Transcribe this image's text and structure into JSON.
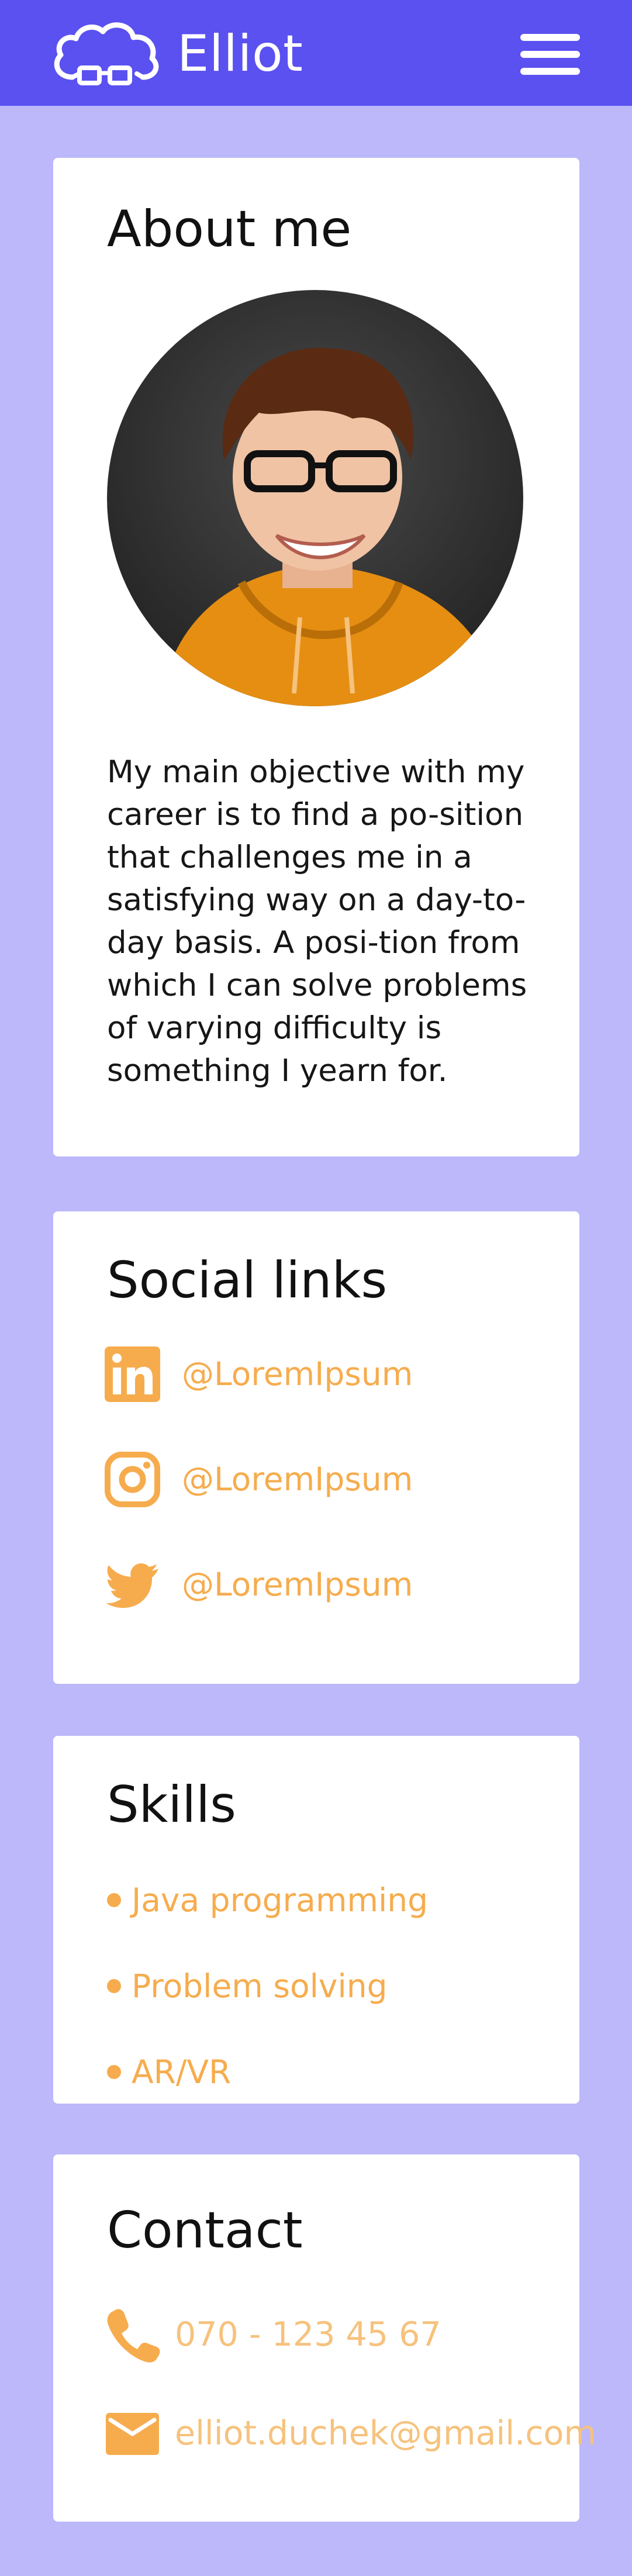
{
  "header": {
    "brand": "Elliot",
    "logo_icon": "cloud-with-glasses-icon",
    "menu_icon": "hamburger-menu-icon",
    "background": "#5a51f0"
  },
  "about": {
    "title": "About me",
    "bio": "My main objective with my career is to find a po-sition that challenges me in a satisfying way on a day-to-day basis. A posi-tion from which I can solve problems of varying difficulty is something I yearn for."
  },
  "social": {
    "title": "Social links",
    "links": [
      {
        "icon": "linkedin-icon",
        "handle": "@LoremIpsum"
      },
      {
        "icon": "instagram-icon",
        "handle": "@LoremIpsum"
      },
      {
        "icon": "twitter-icon",
        "handle": "@LoremIpsum"
      }
    ]
  },
  "skills": {
    "title": "Skills",
    "items": [
      "Java programming",
      "Problem solving",
      "AR/VR"
    ]
  },
  "contact": {
    "title": "Contact",
    "phone": "070 - 123 45 67",
    "email": "elliot.duchek@gmail.com",
    "phone_icon": "phone-icon",
    "email_icon": "envelope-icon"
  },
  "colors": {
    "page_background": "#bcb8fa",
    "card_background": "#ffffff",
    "accent": "#f6ac4d"
  }
}
